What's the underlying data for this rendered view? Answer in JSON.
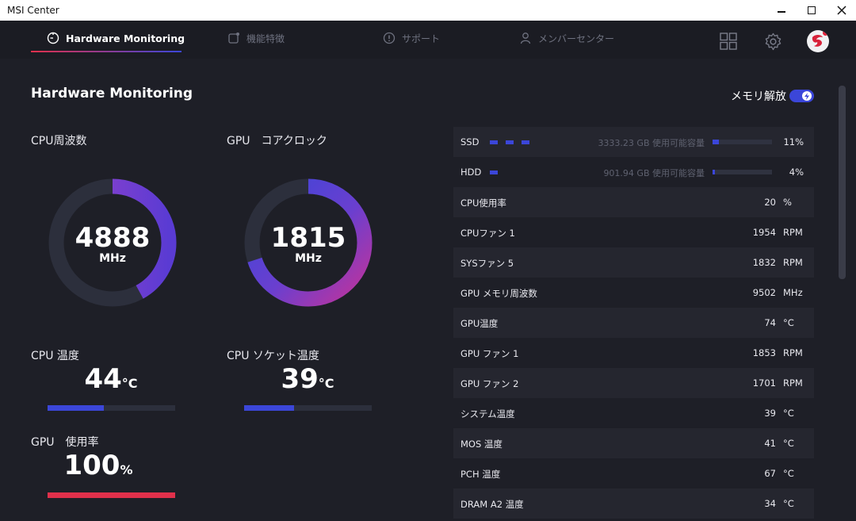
{
  "window": {
    "title": "MSI Center"
  },
  "nav": {
    "tabs": [
      {
        "label": "Hardware Monitoring",
        "active": true
      },
      {
        "label": "機能特徴",
        "active": false
      },
      {
        "label": "サポート",
        "active": false
      },
      {
        "label": "メンバーセンター",
        "active": false
      }
    ]
  },
  "main": {
    "title": "Hardware Monitoring",
    "cpu_freq": {
      "label": "CPU周波数",
      "value": "4888",
      "unit": "MHz",
      "fraction": 0.42
    },
    "gpu_clock": {
      "label": "GPU　コアクロック",
      "value": "1815",
      "unit": "MHz",
      "fraction": 0.7
    },
    "cpu_temp": {
      "label": "CPU 温度",
      "value": "44",
      "unit": "°C",
      "fraction": 0.44
    },
    "cpu_socket_temp": {
      "label": "CPU ソケット温度",
      "value": "39",
      "unit": "°C",
      "fraction": 0.39
    },
    "gpu_usage": {
      "label": "GPU　使用率",
      "value": "100",
      "unit": "%",
      "fraction": 1.0
    }
  },
  "memory_release": {
    "label": "メモリ解放"
  },
  "list": {
    "storage": [
      {
        "name": "SSD",
        "capacity": "3333.23 GB 使用可能容量",
        "percent": "11%",
        "fraction": 0.11,
        "dashes": 3
      },
      {
        "name": "HDD",
        "capacity": "901.94 GB 使用可能容量",
        "percent": "4%",
        "fraction": 0.04,
        "dashes": 1
      }
    ],
    "rows": [
      {
        "name": "CPU使用率",
        "value": "20",
        "unit": "%"
      },
      {
        "name": "CPUファン 1",
        "value": "1954",
        "unit": "RPM"
      },
      {
        "name": "SYSファン 5",
        "value": "1832",
        "unit": "RPM"
      },
      {
        "name": "GPU メモリ周波数",
        "value": "9502",
        "unit": "MHz"
      },
      {
        "name": "GPU温度",
        "value": "74",
        "unit": "°C"
      },
      {
        "name": "GPU ファン 1",
        "value": "1853",
        "unit": "RPM"
      },
      {
        "name": "GPU ファン 2",
        "value": "1701",
        "unit": "RPM"
      },
      {
        "name": "システム温度",
        "value": "39",
        "unit": "°C"
      },
      {
        "name": "MOS 温度",
        "value": "41",
        "unit": "°C"
      },
      {
        "name": "PCH 温度",
        "value": "67",
        "unit": "°C"
      },
      {
        "name": "DRAM A2 温度",
        "value": "34",
        "unit": "°C"
      }
    ]
  },
  "colors": {
    "accent_blue": "#3b46d9",
    "accent_red": "#e0304b",
    "background": "#1e1f27"
  }
}
